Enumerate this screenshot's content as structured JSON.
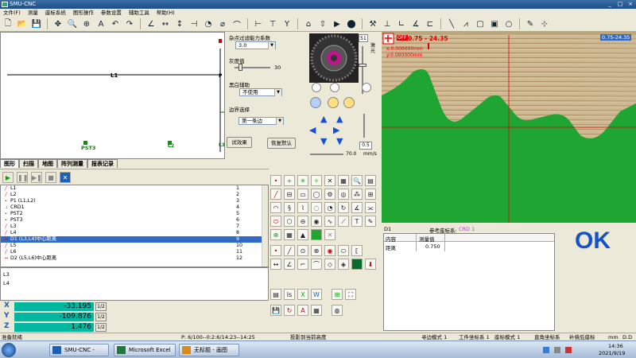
{
  "window": {
    "title": "SMU-CNC",
    "controls": [
      "_",
      "□",
      "×"
    ]
  },
  "menu": [
    "文件(F)",
    "测量",
    "座标系统",
    "图形操作",
    "参数设置",
    "辅助工具",
    "帮助(H)"
  ],
  "canvas": {
    "line_label": "L1",
    "point_label": "P",
    "pst3_label": "PST3",
    "l2_label": "L2",
    "l3_label": "L3"
  },
  "filter_panel": {
    "noise_label": "杂点过滤能力系数",
    "noise_value": "3.0",
    "gray_label": "灰度值",
    "gray_value": "30",
    "bw_label": "黑白辅助",
    "bw_value": "不使用",
    "edge_label": "边界选择",
    "edge_value": "第一条边",
    "test_button": "试效果",
    "restore_button": "恢复默认"
  },
  "camera_panel": {
    "light_value": "51",
    "light_label": "激光",
    "speed_value": "70.0",
    "speed_unit": "mm/s",
    "step_value": "0.5",
    "off_label": "OFF"
  },
  "camera_view": {
    "zoom_label": "0.75-24.35",
    "overlay_line1": "0.75 - 24.35",
    "overlay_line2": "x:0.000000mm",
    "overlay_line3": "y:0.000000mm"
  },
  "tabs": [
    "图形",
    "扫描",
    "地图",
    "阵列测量",
    "报表记录"
  ],
  "features": [
    {
      "icon": "line",
      "name": "L1",
      "num": "1"
    },
    {
      "icon": "line",
      "name": "L2",
      "num": "2"
    },
    {
      "icon": "point",
      "name": "P1 (L1,L2)",
      "num": "3"
    },
    {
      "icon": "crd",
      "name": "CRD1",
      "num": "4"
    },
    {
      "icon": "point",
      "name": "PST2",
      "num": "5"
    },
    {
      "icon": "point",
      "name": "PST3",
      "num": "6"
    },
    {
      "icon": "line",
      "name": "L3",
      "num": "7"
    },
    {
      "icon": "line",
      "name": "L4",
      "num": "8"
    },
    {
      "icon": "dist",
      "name": "D1 (L3,L4)中心距离",
      "num": "9"
    },
    {
      "icon": "line",
      "name": "L5",
      "num": "10"
    },
    {
      "icon": "line",
      "name": "L6",
      "num": "11"
    },
    {
      "icon": "dist",
      "name": "D2 (L5,L6)中心距离",
      "num": "12"
    }
  ],
  "notes": [
    "L3",
    "L4"
  ],
  "coords": {
    "x_label": "X",
    "x_value": "-33.195",
    "y_label": "Y",
    "y_value": "-109.876",
    "z_label": "Z",
    "z_value": "1.476",
    "ratio": "1/2"
  },
  "result": {
    "name": "D1",
    "ref_label": "参考座标系:",
    "ref_value": "CRD 1",
    "col_content": "内容",
    "col_value": "测量值",
    "row_label": "距离",
    "row_value": "0.750",
    "verdict": "OK"
  },
  "status": {
    "ready": "准备就绪",
    "program": "P: 6/100--0:2:6/14:23--14:25",
    "projection": "投影到当前高度",
    "mode": "寻边模式 1",
    "work_coord": "工件坐标系 1",
    "coord_mode": "座标模式 1",
    "rect": "直角坐标系",
    "comp": "补偿后座标",
    "unit": "mm",
    "dd": "D.D"
  },
  "taskbar": {
    "apps": [
      "SMU-CNC -",
      "Microsoft Excel ...",
      "无标题 - 画图"
    ],
    "time": "14:36",
    "date": "2021/9/19"
  },
  "colors": {
    "coord_bg": "#00b8a0",
    "ok_color": "#1452c8",
    "part_green": "#1fa532",
    "crosshair": "#e00000"
  }
}
